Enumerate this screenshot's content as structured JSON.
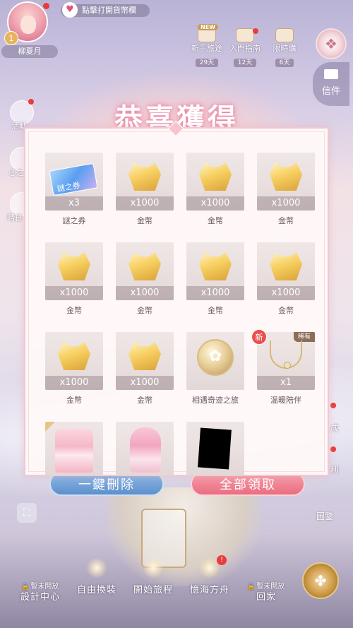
{
  "player": {
    "level": "1",
    "name": "柳夏月"
  },
  "currency_bar": {
    "text": "點擊打開貨幣欄",
    "icon": "heart-icon"
  },
  "events": [
    {
      "label": "新手旅途",
      "days": "29天",
      "badge": "NEW"
    },
    {
      "label": "入門指南",
      "days": "12天"
    },
    {
      "label": "限時購",
      "days": "6天"
    }
  ],
  "mail": {
    "label": "信件"
  },
  "left_side": [
    {
      "label": "活動"
    },
    {
      "label": "心之"
    },
    {
      "label": "晴日"
    }
  ],
  "right_side": [
    {
      "label": "成"
    },
    {
      "label": "利"
    },
    {
      "label": "圖鑒"
    }
  ],
  "dialog": {
    "title": "恭喜獲得",
    "items": [
      {
        "name": "謎之券",
        "qty": "x3",
        "type": "ticket",
        "ticket_text": "謎之券"
      },
      {
        "name": "金幣",
        "qty": "x1000",
        "type": "coin"
      },
      {
        "name": "金幣",
        "qty": "x1000",
        "type": "coin"
      },
      {
        "name": "金幣",
        "qty": "x1000",
        "type": "coin"
      },
      {
        "name": "金幣",
        "qty": "x1000",
        "type": "coin"
      },
      {
        "name": "金幣",
        "qty": "x1000",
        "type": "coin"
      },
      {
        "name": "金幣",
        "qty": "x1000",
        "type": "coin"
      },
      {
        "name": "金幣",
        "qty": "x1000",
        "type": "coin"
      },
      {
        "name": "金幣",
        "qty": "x1000",
        "type": "coin"
      },
      {
        "name": "金幣",
        "qty": "x1000",
        "type": "coin"
      },
      {
        "name": "相遇奇迹之旅",
        "qty": "",
        "type": "medal"
      },
      {
        "name": "溫暖陪伴",
        "qty": "x1",
        "type": "necklace",
        "new_badge": "新",
        "rare_tag": "稀有"
      },
      {
        "name": "",
        "qty": "",
        "type": "cake"
      },
      {
        "name": "",
        "qty": "",
        "type": "cake-girl"
      },
      {
        "name": "",
        "qty": "",
        "type": "blacked"
      }
    ],
    "delete_button": "一鍵刪除",
    "claim_button": "全部領取"
  },
  "bottom_nav": [
    {
      "label": "設計中心",
      "locked": "暫未開放"
    },
    {
      "label": "自由換裝"
    },
    {
      "label": "開始旅程"
    },
    {
      "label": "憶海方舟"
    },
    {
      "label": "回家",
      "locked": "暫未開放"
    }
  ],
  "colors": {
    "accent_pink": "#ea6d80",
    "accent_blue": "#5e8fcc",
    "badge_red": "#e83c3c"
  }
}
